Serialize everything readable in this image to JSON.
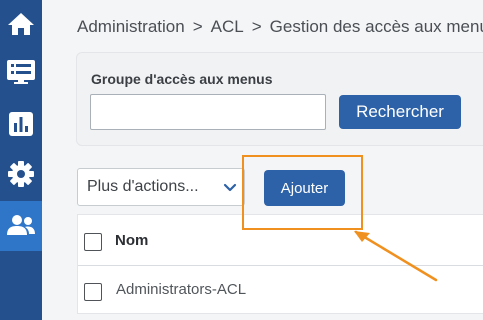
{
  "sidebar": {
    "items": [
      {
        "icon": "home-icon",
        "active": false
      },
      {
        "icon": "monitor-list-icon",
        "active": false
      },
      {
        "icon": "bar-chart-icon",
        "active": false
      },
      {
        "icon": "gear-icon",
        "active": false
      },
      {
        "icon": "users-icon",
        "active": true
      }
    ]
  },
  "breadcrumb": {
    "items": [
      "Administration",
      "ACL",
      "Gestion des accès aux menus"
    ],
    "separator": ">"
  },
  "search": {
    "label": "Groupe d'accès aux menus",
    "value": "",
    "placeholder": "",
    "button_label": "Rechercher"
  },
  "actions": {
    "more_label": "Plus d'actions...",
    "add_label": "Ajouter"
  },
  "table": {
    "columns": [
      "Nom"
    ],
    "rows": [
      {
        "name": "Administrators-ACL"
      }
    ]
  },
  "colors": {
    "sidebar": "#24518d",
    "sidebar_active": "#2f76c8",
    "primary_button": "#2d62a8",
    "highlight": "#f0901e"
  }
}
